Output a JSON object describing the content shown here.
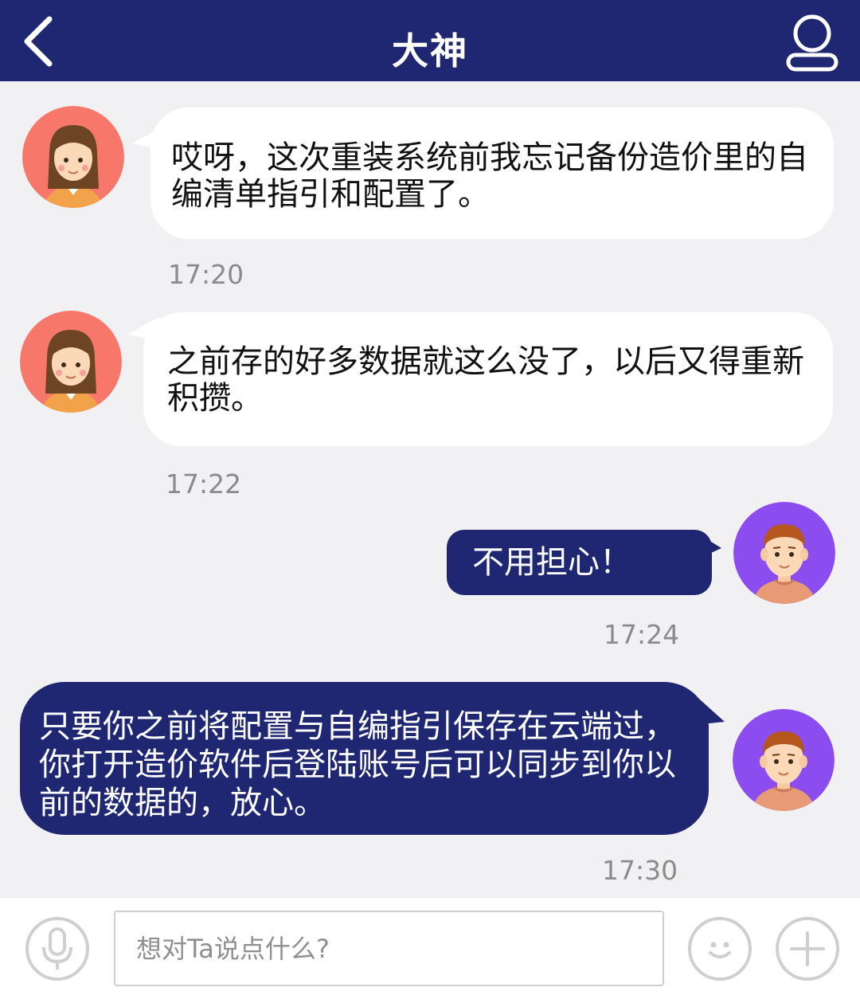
{
  "header": {
    "title": "大神",
    "back_icon": "chevron-left-icon",
    "profile_icon": "user-icon",
    "background_color": "#1f2672"
  },
  "messages": [
    {
      "sender": "other",
      "text": "哎呀，这次重装系统前我忘记备份造价里的自编清单指引和配置了。",
      "time": "17:20"
    },
    {
      "sender": "other",
      "text": "之前存的好多数据就这么没了，以后又得重新积攒。",
      "time": "17:22"
    },
    {
      "sender": "self",
      "text": "不用担心！",
      "time": "17:24"
    },
    {
      "sender": "self",
      "text": "只要你之前将配置与自编指引保存在云端过，你打开造价软件后登陆账号后可以同步到你以前的数据的，放心。",
      "time": "17:30"
    }
  ],
  "input_bar": {
    "placeholder": "想对Ta说点什么?",
    "voice_icon": "microphone-icon",
    "emoji_icon": "smiley-icon",
    "add_icon": "plus-icon"
  },
  "colors": {
    "outgoing_bubble": "#1f2672",
    "incoming_bubble": "#ffffff",
    "background": "#f1f1f3",
    "female_avatar_bg": "#f7786b",
    "male_avatar_bg": "#8b4cf0"
  }
}
